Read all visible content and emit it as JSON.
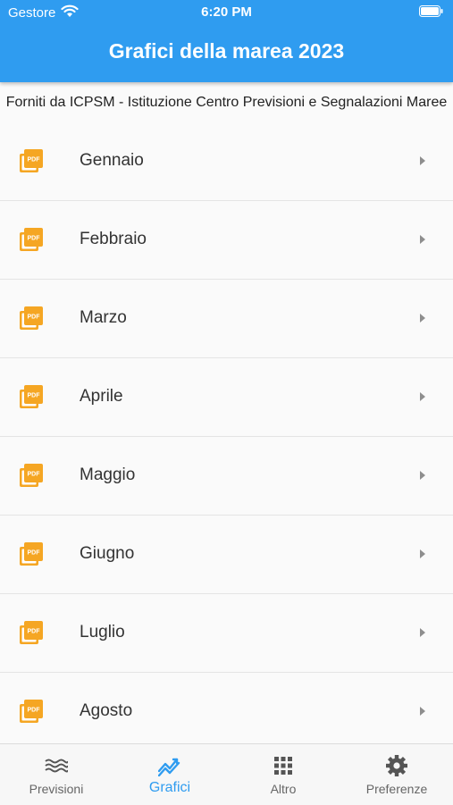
{
  "status_bar": {
    "carrier": "Gestore",
    "time": "6:20 PM"
  },
  "header": {
    "title": "Grafici della marea 2023"
  },
  "source_note": "Forniti da ICPSM - Istituzione Centro Previsioni e Segnalazioni Maree",
  "pdf_icon_text": "PDF",
  "months": [
    {
      "label": "Gennaio"
    },
    {
      "label": "Febbraio"
    },
    {
      "label": "Marzo"
    },
    {
      "label": "Aprile"
    },
    {
      "label": "Maggio"
    },
    {
      "label": "Giugno"
    },
    {
      "label": "Luglio"
    },
    {
      "label": "Agosto"
    }
  ],
  "tabs": [
    {
      "label": "Previsioni",
      "icon": "waves-icon"
    },
    {
      "label": "Grafici",
      "icon": "chart-line-icon",
      "active": true
    },
    {
      "label": "Altro",
      "icon": "grid-icon"
    },
    {
      "label": "Preferenze",
      "icon": "gear-icon"
    }
  ],
  "colors": {
    "accent": "#2f9cf0",
    "pdf_orange": "#f5a623"
  }
}
